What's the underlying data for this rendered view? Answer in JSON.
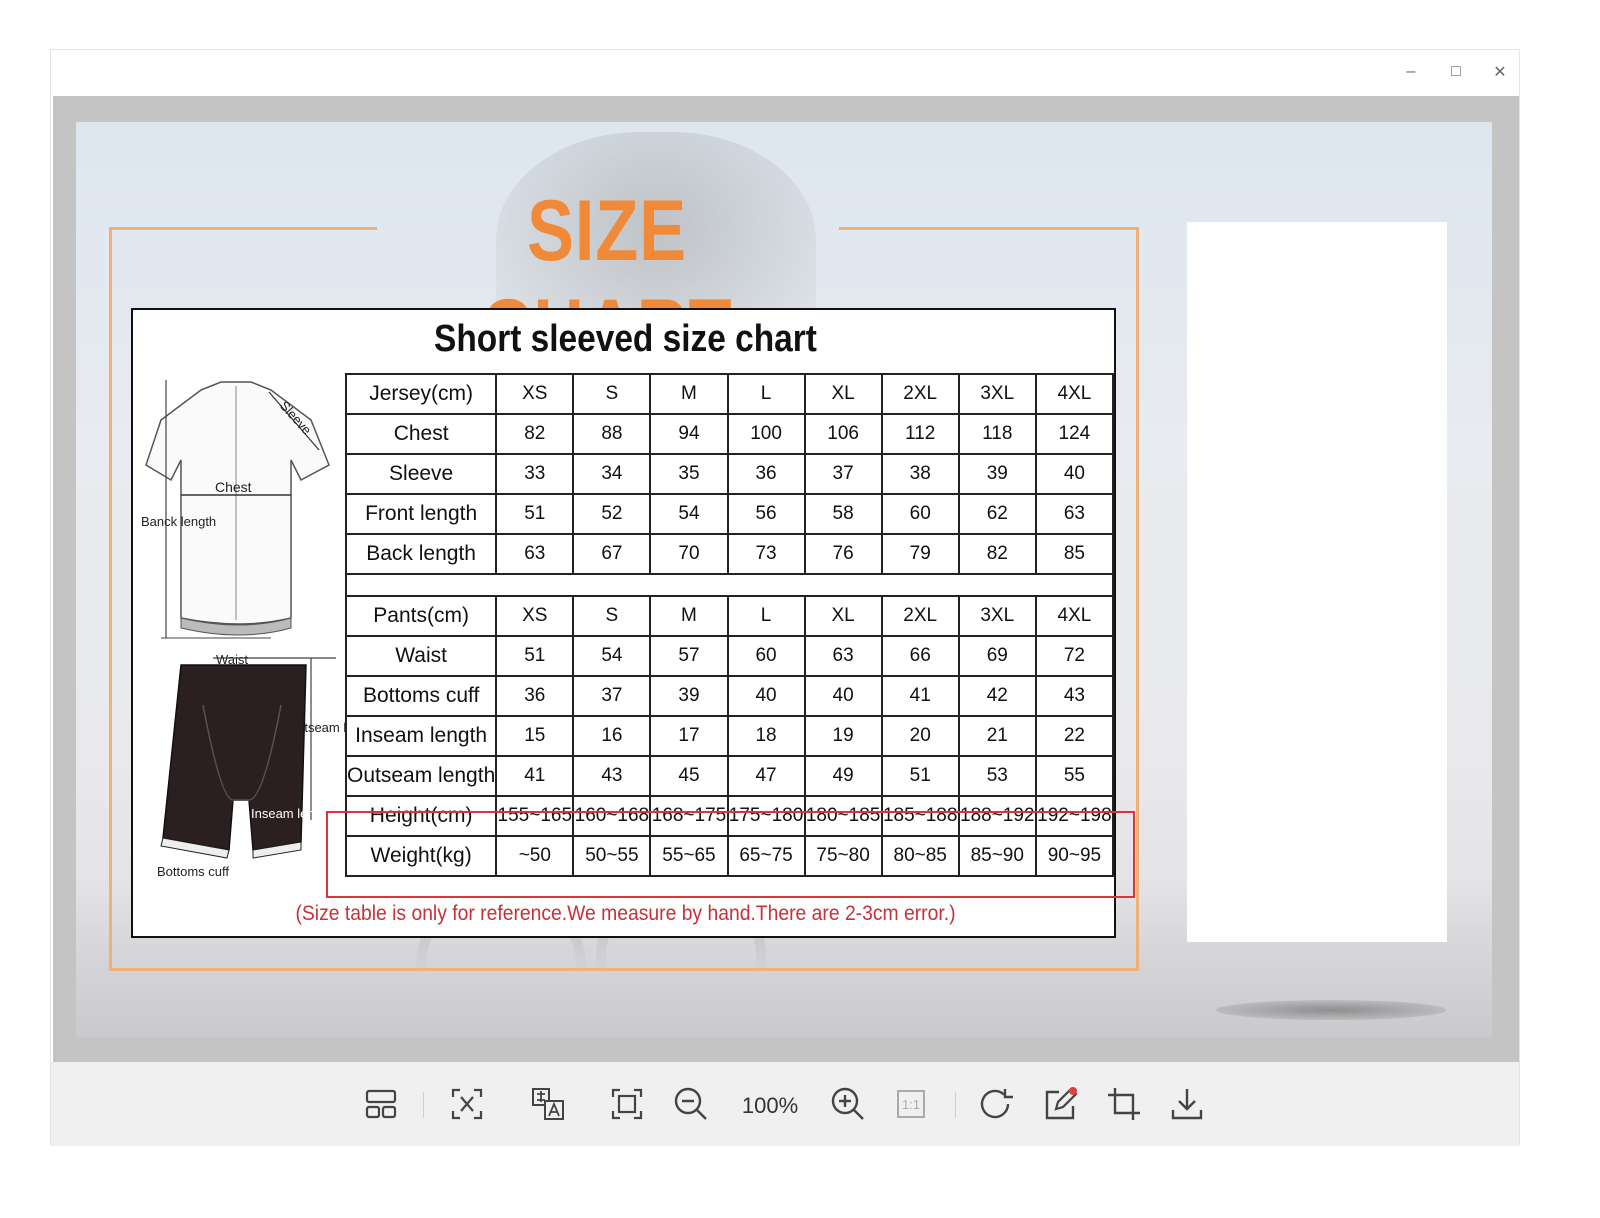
{
  "window": {
    "controls": {
      "minimize": "–",
      "maximize": "□",
      "close": "✕"
    }
  },
  "image": {
    "banner_title": "SIZE CHART",
    "chart_title": "Short sleeved size chart",
    "illustration_labels": {
      "sleeve": "Sleeve",
      "chest": "Chest",
      "back_length": "Banck length",
      "waist": "Waist",
      "outseam_length": "Outseam length",
      "inseam_length": "Inseam length",
      "bottoms_cuff": "Bottoms cuff"
    },
    "jersey": {
      "header": [
        "Jersey(cm)",
        "XS",
        "S",
        "M",
        "L",
        "XL",
        "2XL",
        "3XL",
        "4XL"
      ],
      "rows": [
        [
          "Chest",
          "82",
          "88",
          "94",
          "100",
          "106",
          "112",
          "118",
          "124"
        ],
        [
          "Sleeve",
          "33",
          "34",
          "35",
          "36",
          "37",
          "38",
          "39",
          "40"
        ],
        [
          "Front length",
          "51",
          "52",
          "54",
          "56",
          "58",
          "60",
          "62",
          "63"
        ],
        [
          "Back length",
          "63",
          "67",
          "70",
          "73",
          "76",
          "79",
          "82",
          "85"
        ]
      ]
    },
    "pants": {
      "header": [
        "Pants(cm)",
        "XS",
        "S",
        "M",
        "L",
        "XL",
        "2XL",
        "3XL",
        "4XL"
      ],
      "rows": [
        [
          "Waist",
          "51",
          "54",
          "57",
          "60",
          "63",
          "66",
          "69",
          "72"
        ],
        [
          "Bottoms cuff",
          "36",
          "37",
          "39",
          "40",
          "40",
          "41",
          "42",
          "43"
        ],
        [
          "Inseam length",
          "15",
          "16",
          "17",
          "18",
          "19",
          "20",
          "21",
          "22"
        ],
        [
          "Outseam length",
          "41",
          "43",
          "45",
          "47",
          "49",
          "51",
          "53",
          "55"
        ],
        [
          "Height(cm)",
          "155~165",
          "160~168",
          "168~175",
          "175~180",
          "180~185",
          "185~188",
          "188~192",
          "192~198"
        ],
        [
          "Weight(kg)",
          "~50",
          "50~55",
          "55~65",
          "65~75",
          "75~80",
          "80~85",
          "85~90",
          "90~95"
        ]
      ]
    },
    "note": "(Size table is only for reference.We measure by hand.There are 2-3cm error.)"
  },
  "toolbar": {
    "zoom_level": "100%",
    "actual_size_label": "1:1",
    "icons": [
      "layout-icon",
      "extract-text-icon",
      "translate-icon",
      "fit-screen-icon",
      "zoom-out-icon",
      "zoom-in-icon",
      "actual-size-icon",
      "rotate-icon",
      "edit-icon",
      "crop-icon",
      "download-icon"
    ]
  },
  "colors": {
    "title_orange": "#f08a38",
    "frame_orange": "#f0b07a",
    "highlight_red": "#d9363c",
    "note_red": "#c8303a",
    "edit_badge": "#e04040"
  }
}
